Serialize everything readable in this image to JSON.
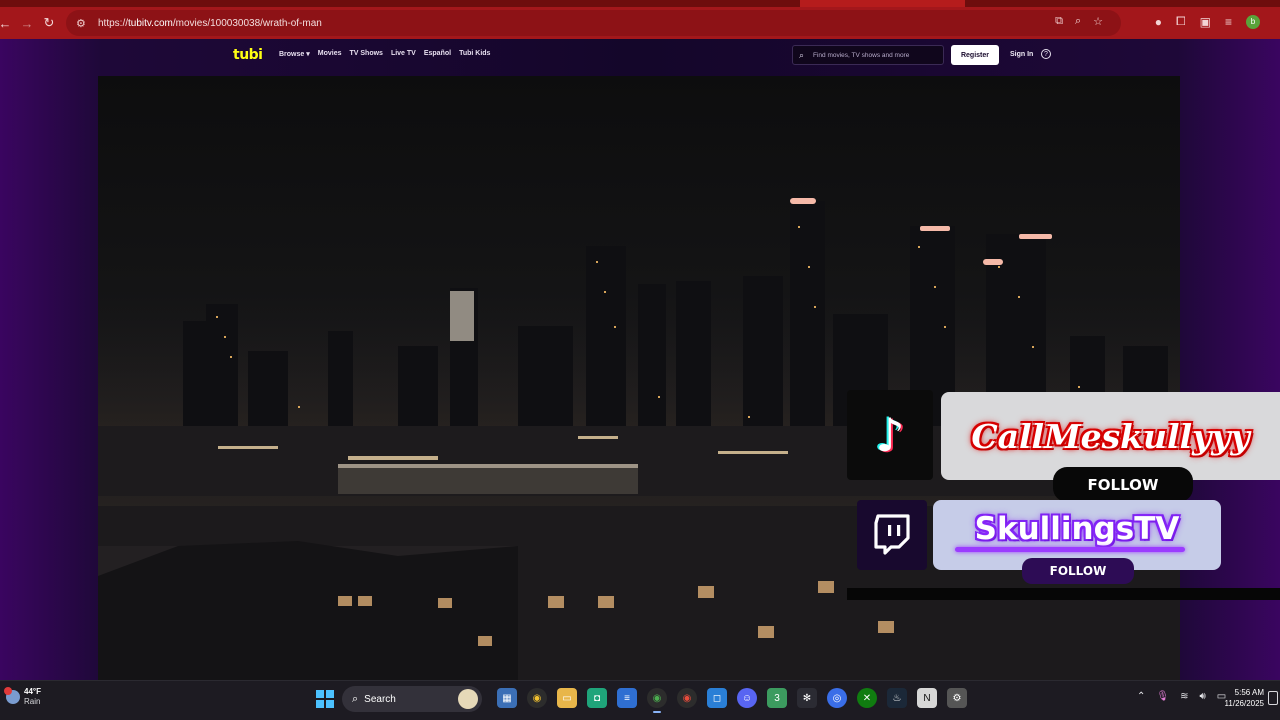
{
  "browser": {
    "url_prefix": "https://",
    "url_host": "tubitv.com",
    "url_path": "/movies/100030038/wrath-of-man"
  },
  "tubi": {
    "logo": "tubi",
    "nav": [
      "Browse ▾",
      "Movies",
      "TV Shows",
      "Live TV",
      "Español",
      "Tubi Kids"
    ],
    "search_placeholder": "Find movies, TV shows and more",
    "register_label": "Register",
    "signin_label": "Sign In",
    "help_label": "?"
  },
  "overlay": {
    "tiktok_name": "CallMeskullyyy",
    "tiktok_follow": "FOLLOW",
    "twitch_name": "SkullingsTV",
    "twitch_follow": "FOLLOW"
  },
  "taskbar": {
    "temperature": "44°F",
    "condition": "Rain",
    "search_label": "Search",
    "time": "5:56 AM",
    "date": "11/26/2025"
  },
  "colors": {
    "browser_red": "#a3171b",
    "tubi_yellow": "#ffff13",
    "tubi_purple": "#3a0560",
    "tiktok_red": "#e00000",
    "twitch_purple": "#8e2bff"
  }
}
